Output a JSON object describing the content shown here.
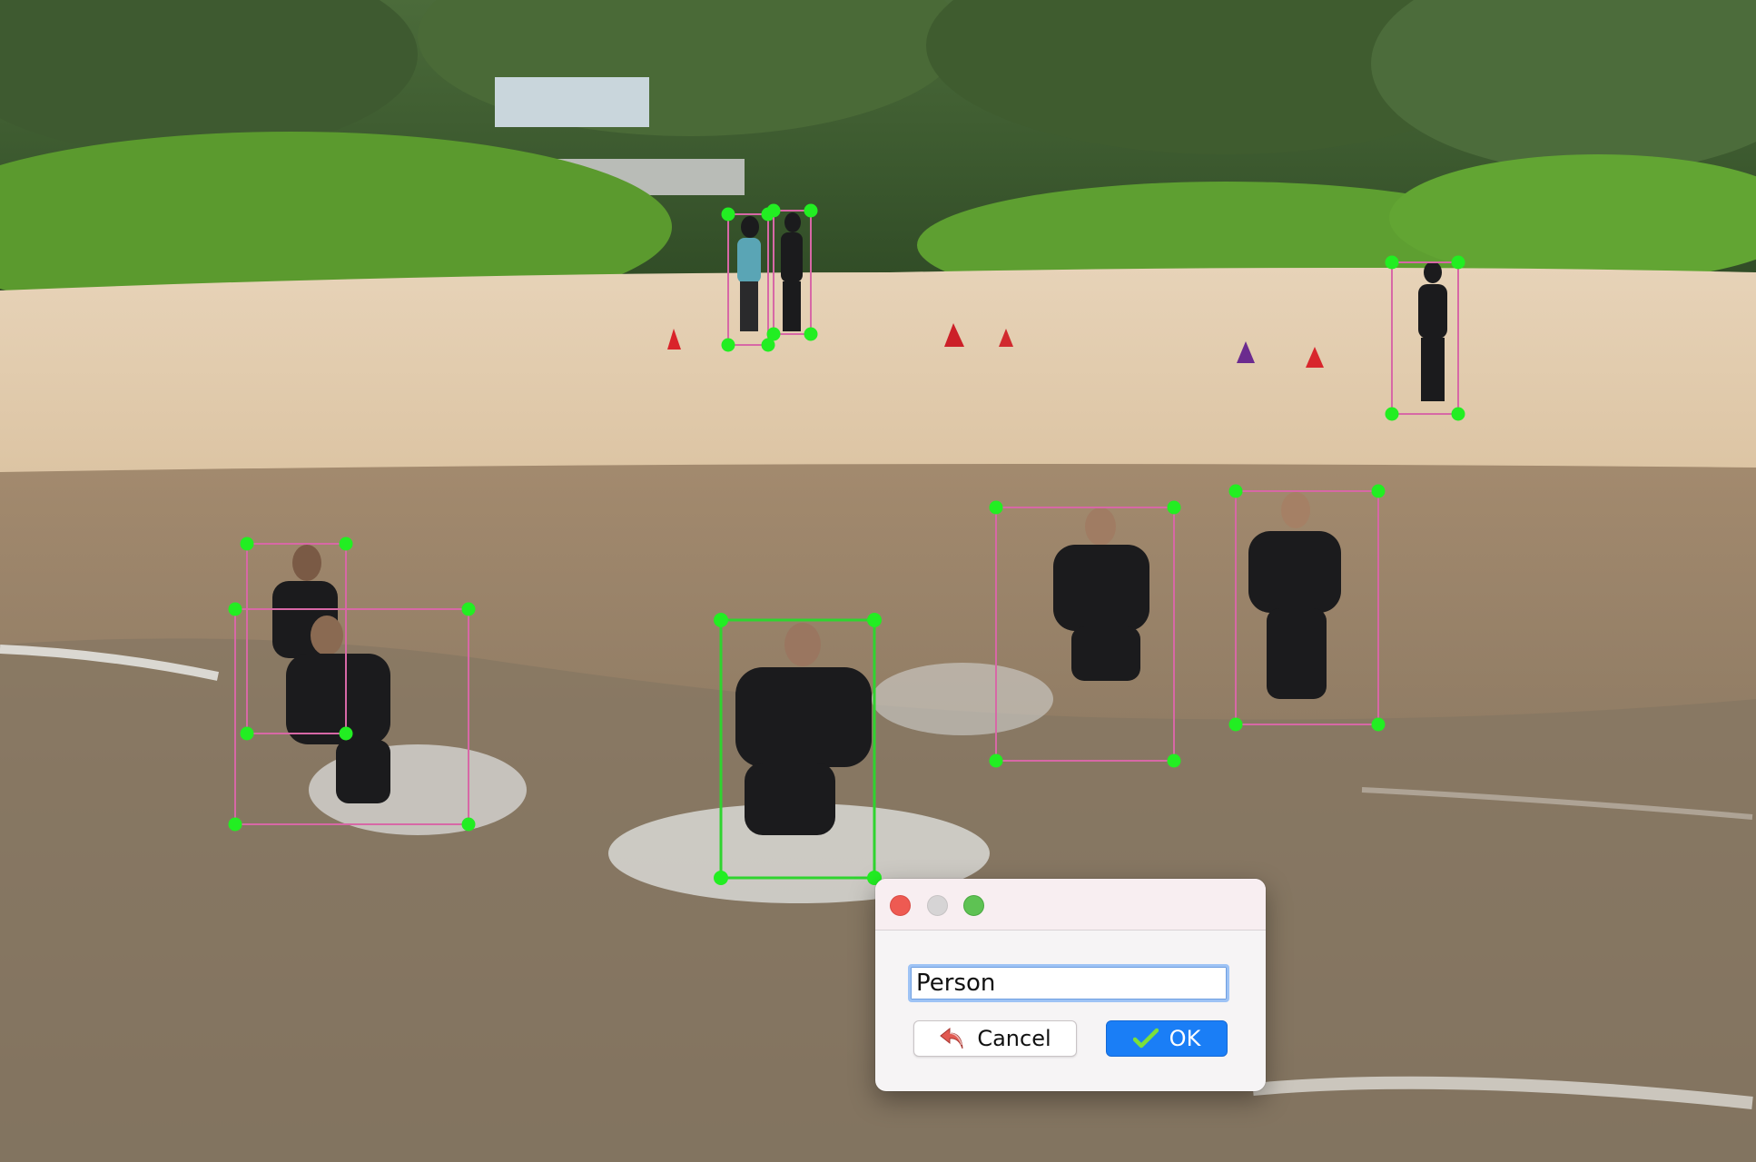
{
  "annotations": {
    "boxes": [
      {
        "name": "bbox-person-1",
        "selected": false
      },
      {
        "name": "bbox-person-2",
        "selected": false
      },
      {
        "name": "bbox-person-3",
        "selected": false
      },
      {
        "name": "bbox-person-4",
        "selected": false
      },
      {
        "name": "bbox-person-5",
        "selected": true
      },
      {
        "name": "bbox-person-6",
        "selected": false
      },
      {
        "name": "bbox-person-7",
        "selected": false
      },
      {
        "name": "bbox-person-8",
        "selected": false
      }
    ],
    "box_color": "#d768a6",
    "selected_color": "#2fd42f",
    "handle_color": "#22ee22"
  },
  "dialog": {
    "label_value": "Person",
    "cancel_label": "Cancel",
    "ok_label": "OK",
    "cancel_icon": "undo-arrow-icon",
    "ok_icon": "checkmark-icon",
    "accent_color": "#1a7ef6"
  }
}
